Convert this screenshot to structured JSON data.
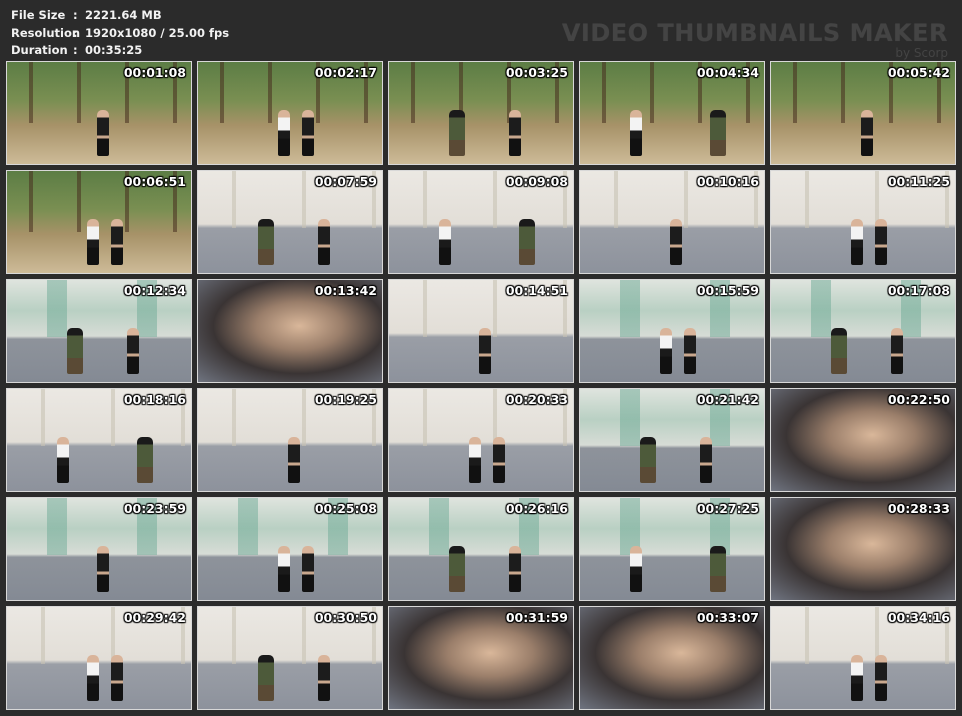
{
  "file_info": {
    "file_size_label": "File Size",
    "file_size_value": "2221.64 MB",
    "resolution_label": "Resolution",
    "resolution_value": "1920x1080 / 25.00 fps",
    "duration_label": "Duration",
    "duration_value": "00:35:25",
    "separator": ":"
  },
  "branding": {
    "title": "VIDEO THUMBNAILS MAKER",
    "subtitle": "by Scorp"
  },
  "thumbnails": [
    {
      "time": "00:01:08",
      "scene": "forest"
    },
    {
      "time": "00:02:17",
      "scene": "forest"
    },
    {
      "time": "00:03:25",
      "scene": "forest"
    },
    {
      "time": "00:04:34",
      "scene": "forest"
    },
    {
      "time": "00:05:42",
      "scene": "forest"
    },
    {
      "time": "00:06:51",
      "scene": "forest"
    },
    {
      "time": "00:07:59",
      "scene": "room"
    },
    {
      "time": "00:09:08",
      "scene": "room"
    },
    {
      "time": "00:10:16",
      "scene": "room"
    },
    {
      "time": "00:11:25",
      "scene": "room"
    },
    {
      "time": "00:12:34",
      "scene": "green"
    },
    {
      "time": "00:13:42",
      "scene": "close"
    },
    {
      "time": "00:14:51",
      "scene": "room"
    },
    {
      "time": "00:15:59",
      "scene": "green"
    },
    {
      "time": "00:17:08",
      "scene": "green"
    },
    {
      "time": "00:18:16",
      "scene": "room"
    },
    {
      "time": "00:19:25",
      "scene": "room"
    },
    {
      "time": "00:20:33",
      "scene": "room"
    },
    {
      "time": "00:21:42",
      "scene": "green"
    },
    {
      "time": "00:22:50",
      "scene": "close"
    },
    {
      "time": "00:23:59",
      "scene": "green"
    },
    {
      "time": "00:25:08",
      "scene": "green"
    },
    {
      "time": "00:26:16",
      "scene": "green"
    },
    {
      "time": "00:27:25",
      "scene": "green"
    },
    {
      "time": "00:28:33",
      "scene": "close"
    },
    {
      "time": "00:29:42",
      "scene": "room"
    },
    {
      "time": "00:30:50",
      "scene": "room"
    },
    {
      "time": "00:31:59",
      "scene": "close"
    },
    {
      "time": "00:33:07",
      "scene": "close"
    },
    {
      "time": "00:34:16",
      "scene": "room"
    }
  ]
}
